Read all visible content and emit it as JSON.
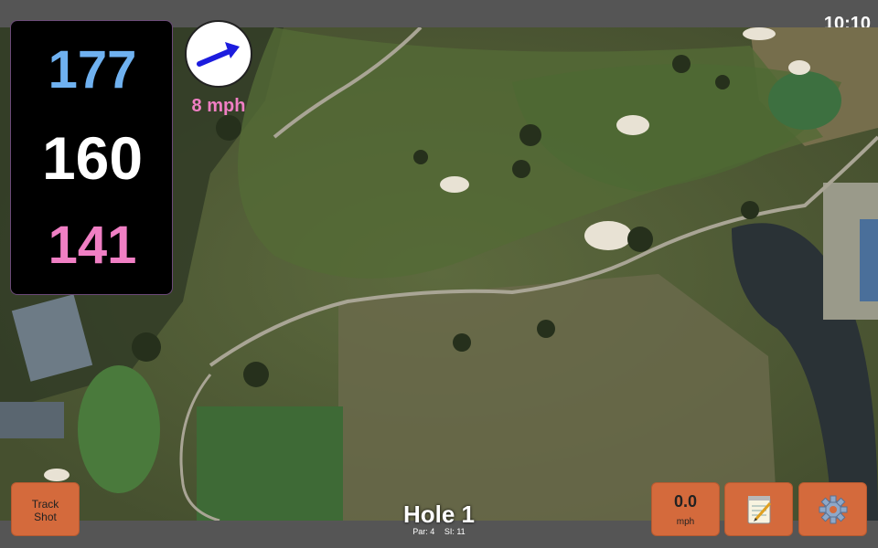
{
  "status": {
    "time": "10:10"
  },
  "distances": {
    "back": "177",
    "center": "160",
    "front": "141"
  },
  "wind": {
    "speed_label": "8 mph",
    "direction_icon": "wind-arrow-icon"
  },
  "hole": {
    "title": "Hole 1",
    "par_label": "Par: 4",
    "si_label": "SI: 11"
  },
  "buttons": {
    "track_shot_line1": "Track",
    "track_shot_line2": "Shot",
    "speed_value": "0.0",
    "speed_unit": "mph",
    "notes_icon": "notepad-icon",
    "settings_icon": "gear-icon"
  },
  "colors": {
    "back": "#6fb1f0",
    "center": "#ffffff",
    "front": "#f07fc4",
    "button": "#d46a3c"
  }
}
